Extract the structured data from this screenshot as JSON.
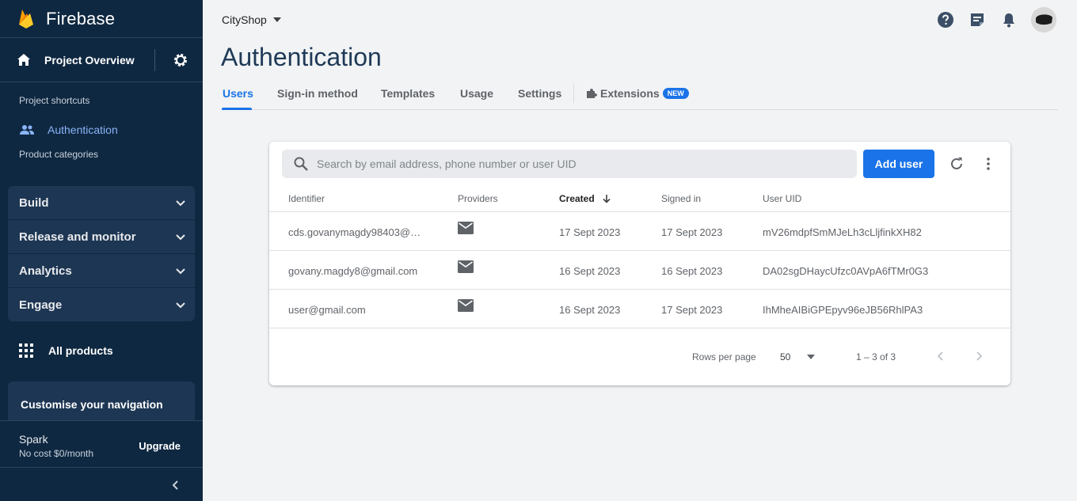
{
  "app": {
    "name": "Firebase"
  },
  "sidebar": {
    "overview_label": "Project Overview",
    "shortcuts_label": "Project shortcuts",
    "active_shortcut": "Authentication",
    "categories_label": "Product categories",
    "categories": [
      {
        "label": "Build"
      },
      {
        "label": "Release and monitor"
      },
      {
        "label": "Analytics"
      },
      {
        "label": "Engage"
      }
    ],
    "all_products": "All products",
    "customise": "Customise your navigation",
    "plan": {
      "name": "Spark",
      "cost": "No cost $0/month",
      "upgrade": "Upgrade"
    }
  },
  "topbar": {
    "project": "CityShop"
  },
  "page": {
    "title": "Authentication",
    "tabs": [
      {
        "label": "Users"
      },
      {
        "label": "Sign-in method"
      },
      {
        "label": "Templates"
      },
      {
        "label": "Usage"
      },
      {
        "label": "Settings"
      },
      {
        "label": "Extensions"
      }
    ],
    "new_badge": "NEW"
  },
  "users": {
    "search_placeholder": "Search by email address, phone number or user UID",
    "add_user": "Add user",
    "columns": [
      "Identifier",
      "Providers",
      "Created",
      "Signed in",
      "User UID"
    ],
    "sorted_column": "Created",
    "rows": [
      {
        "identifier": "cds.govanymagdy98403@…",
        "provider": "email",
        "created": "17 Sept 2023",
        "signed_in": "17 Sept 2023",
        "uid": "mV26mdpfSmMJeLh3cLljfinkXH82"
      },
      {
        "identifier": "govany.magdy8@gmail.com",
        "provider": "email",
        "created": "16 Sept 2023",
        "signed_in": "16 Sept 2023",
        "uid": "DA02sgDHaycUfzc0AVpA6fTMr0G3"
      },
      {
        "identifier": "user@gmail.com",
        "provider": "email",
        "created": "16 Sept 2023",
        "signed_in": "17 Sept 2023",
        "uid": "IhMheAIBiGPEpyv96eJB56RhlPA3"
      }
    ],
    "pagination": {
      "rows_label": "Rows per page",
      "rows_value": "50",
      "range": "1 – 3 of 3"
    }
  },
  "colors": {
    "sidebar_bg": "#0f2841",
    "accent": "#1a73e8",
    "page_bg": "#f1f3f4",
    "title": "#1f3a57"
  }
}
